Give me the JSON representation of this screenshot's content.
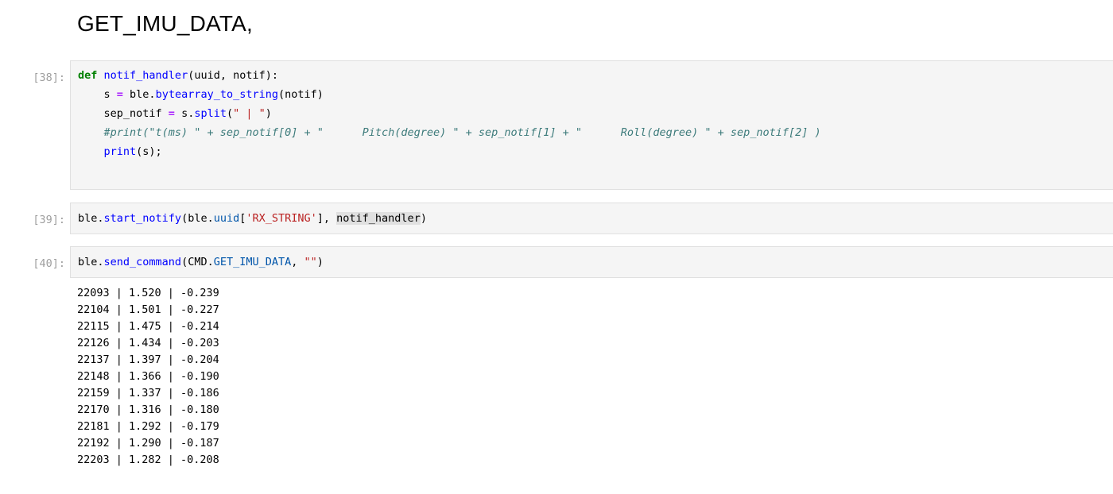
{
  "heading": "GET_IMU_DATA,",
  "cells": [
    {
      "prompt": "[38]:",
      "code": {
        "l1": {
          "kw": "def",
          "name": "notif_handler",
          "args": "(uuid, notif):"
        },
        "l2": {
          "pre": "    s ",
          "eq": "=",
          "mid": " ble.",
          "call": "bytearray_to_string",
          "post": "(notif)"
        },
        "l3": {
          "pre": "    sep_notif ",
          "eq": "=",
          "mid": " s.",
          "call": "split",
          "open": "(",
          "str": "\" | \"",
          "close": ")"
        },
        "l4": "    #print(\"t(ms) \" + sep_notif[0] + \"      Pitch(degree) \" + sep_notif[1] + \"      Roll(degree) \" + sep_notif[2] )",
        "l5": {
          "pre": "    ",
          "call": "print",
          "post": "(s);"
        }
      }
    },
    {
      "prompt": "[39]:",
      "code": {
        "a": "ble.",
        "call": "start_notify",
        "b": "(ble.",
        "attr": "uuid",
        "c": "[",
        "str": "'RX_STRING'",
        "d": "], ",
        "hl": "notif_handler",
        "e": ")"
      }
    },
    {
      "prompt": "[40]:",
      "code": {
        "a": "ble.",
        "call": "send_command",
        "b": "(CMD.",
        "attr": "GET_IMU_DATA",
        "c": ", ",
        "str": "\"\"",
        "d": ")"
      }
    }
  ],
  "output": [
    "22093 | 1.520 | -0.239",
    "22104 | 1.501 | -0.227",
    "22115 | 1.475 | -0.214",
    "22126 | 1.434 | -0.203",
    "22137 | 1.397 | -0.204",
    "22148 | 1.366 | -0.190",
    "22159 | 1.337 | -0.186",
    "22170 | 1.316 | -0.180",
    "22181 | 1.292 | -0.179",
    "22192 | 1.290 | -0.187",
    "22203 | 1.282 | -0.208"
  ]
}
